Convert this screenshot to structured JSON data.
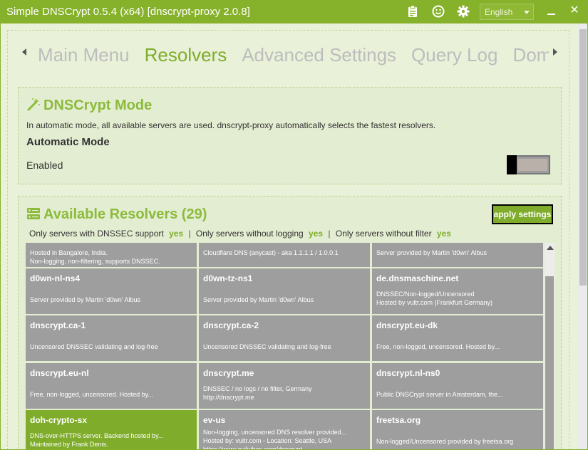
{
  "window": {
    "title": "Simple DNSCrypt 0.5.4 (x64) [dnscrypt-proxy 2.0.8]",
    "language": "English",
    "icons": [
      "clipboard-icon",
      "smiley-icon",
      "gear-icon"
    ],
    "close_glyph": "✕"
  },
  "tabs": [
    {
      "label": "Main Menu",
      "active": false
    },
    {
      "label": "Resolvers",
      "active": true
    },
    {
      "label": "Advanced Settings",
      "active": false
    },
    {
      "label": "Query Log",
      "active": false
    },
    {
      "label": "Domain Block Log",
      "active": false
    }
  ],
  "mode": {
    "title": "DNSCrypt Mode",
    "description": "In automatic mode, all available servers are used. dnscrypt-proxy automatically selects the fastest resolvers.",
    "subtitle": "Automatic Mode",
    "state_label": "Enabled"
  },
  "resolvers": {
    "title": "Available Resolvers (29)",
    "apply_label": "apply settings",
    "filters": {
      "dnssec": "Only servers with DNSSEC support",
      "nolog": "Only servers without logging",
      "nofilter": "Only servers without filter",
      "yes": "yes",
      "sep": "|"
    },
    "tiles": [
      {
        "name": "",
        "desc": "Hosted in Bangalore, India.\nNon-logging, non-filtering, supports DNSSEC.",
        "selected": false
      },
      {
        "name": "",
        "desc": "Cloudflare DNS (anycast) - aka 1.1.1.1 / 1.0.0.1",
        "selected": false
      },
      {
        "name": "",
        "desc": "Server provided by Martin 'd0wn' Albus",
        "selected": false
      },
      {
        "name": "d0wn-nl-ns4",
        "desc": "Server provided by Martin 'd0wn' Albus",
        "selected": false
      },
      {
        "name": "d0wn-tz-ns1",
        "desc": "Server provided by Martin 'd0wn' Albus",
        "selected": false
      },
      {
        "name": "de.dnsmaschine.net",
        "desc": "DNSSEC/Non-logged/Uncensored\nHosted by vultr.com (Frankfurt Germany)",
        "selected": false
      },
      {
        "name": "dnscrypt.ca-1",
        "desc": "Uncensored DNSSEC validating and log-free",
        "selected": false
      },
      {
        "name": "dnscrypt.ca-2",
        "desc": "Uncensored DNSSEC validating and log-free",
        "selected": false
      },
      {
        "name": "dnscrypt.eu-dk",
        "desc": "Free, non-logged, uncensored. Hosted by...",
        "selected": false
      },
      {
        "name": "dnscrypt.eu-nl",
        "desc": "Free, non-logged, uncensored. Hosted by...",
        "selected": false
      },
      {
        "name": "dnscrypt.me",
        "desc": "DNSSEC / no logs / no filter, Germany\nhttp://dnscrypt.me",
        "selected": false
      },
      {
        "name": "dnscrypt.nl-ns0",
        "desc": "Public DNSCrypt server in Amsterdam, the...",
        "selected": false
      },
      {
        "name": "doh-crypto-sx",
        "desc": "DNS-over-HTTPS server. Backend hosted by...\nMaintained by Frank Denis.",
        "selected": true
      },
      {
        "name": "ev-us",
        "desc": "Non-logging, uncensored DNS resolver provided...\nHosted by: vultr.com - Location: Seattle, USA\nhttps://www.evilvibes.com/dnscrypt",
        "selected": false
      },
      {
        "name": "freetsa.org",
        "desc": "Non-logged/Uncensored provided by freetsa.org",
        "selected": false
      }
    ]
  }
}
